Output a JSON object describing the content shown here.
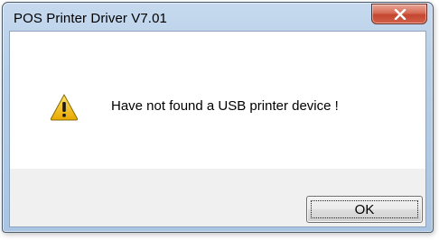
{
  "window": {
    "title": "POS Printer Driver V7.01",
    "close_icon": "close-icon"
  },
  "dialog": {
    "icon": "warning-icon",
    "message": "Have not found a USB printer device !"
  },
  "buttons": {
    "ok_label": "OK"
  },
  "colors": {
    "titlebar": "#b6cfe8",
    "close_button": "#c4452f",
    "content_background": "#ffffff",
    "button_bar_background": "#f0f0f0",
    "warning_yellow": "#f2c318"
  }
}
